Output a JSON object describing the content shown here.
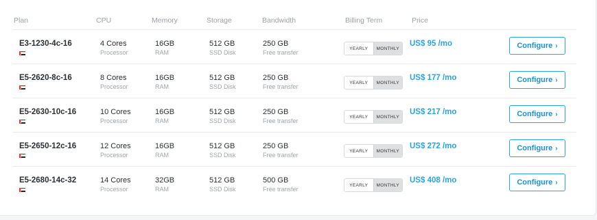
{
  "headers": {
    "plan": "Plan",
    "cpu": "CPU",
    "memory": "Memory",
    "storage": "Storage",
    "bandwidth": "Bandwidth",
    "billing_term": "Billing Term",
    "price": "Price"
  },
  "billing_options": {
    "yearly": "YEARLY",
    "monthly": "MONTHLY",
    "selected": "MONTHLY"
  },
  "button": {
    "label": "Configure",
    "icon": "chevron-right-icon"
  },
  "flag": {
    "icon": "uae-flag-icon",
    "colors": [
      "#e53935",
      "#00843d",
      "#ffffff",
      "#222222"
    ]
  },
  "accent_color": "#29a3e3",
  "rows": [
    {
      "plan": "E3-1230-4c-16",
      "cpu": "4 Cores",
      "cpu_sub": "Processor",
      "memory": "16GB",
      "memory_sub": "RAM",
      "storage": "512 GB",
      "storage_sub": "SSD Disk",
      "bandwidth": "250 GB",
      "bandwidth_sub": "Free transfer",
      "price": "US$ 95 /mo"
    },
    {
      "plan": "E5-2620-8c-16",
      "cpu": "8 Cores",
      "cpu_sub": "Processor",
      "memory": "16GB",
      "memory_sub": "RAM",
      "storage": "512 GB",
      "storage_sub": "SSD Disk",
      "bandwidth": "250 GB",
      "bandwidth_sub": "Free transfer",
      "price": "US$ 177 /mo"
    },
    {
      "plan": "E5-2630-10c-16",
      "cpu": "10 Cores",
      "cpu_sub": "Processor",
      "memory": "16GB",
      "memory_sub": "RAM",
      "storage": "512 GB",
      "storage_sub": "SSD Disk",
      "bandwidth": "250 GB",
      "bandwidth_sub": "Free transfer",
      "price": "US$ 217 /mo"
    },
    {
      "plan": "E5-2650-12c-16",
      "cpu": "12 Cores",
      "cpu_sub": "Processor",
      "memory": "16GB",
      "memory_sub": "RAM",
      "storage": "512 GB",
      "storage_sub": "SSD Disk",
      "bandwidth": "250 GB",
      "bandwidth_sub": "Free transfer",
      "price": "US$ 272 /mo"
    },
    {
      "plan": "E5-2680-14c-32",
      "cpu": "14 Cores",
      "cpu_sub": "Processor",
      "memory": "32GB",
      "memory_sub": "RAM",
      "storage": "512 GB",
      "storage_sub": "SSD Disk",
      "bandwidth": "500 GB",
      "bandwidth_sub": "Free transfer",
      "price": "US$ 408 /mo"
    }
  ]
}
